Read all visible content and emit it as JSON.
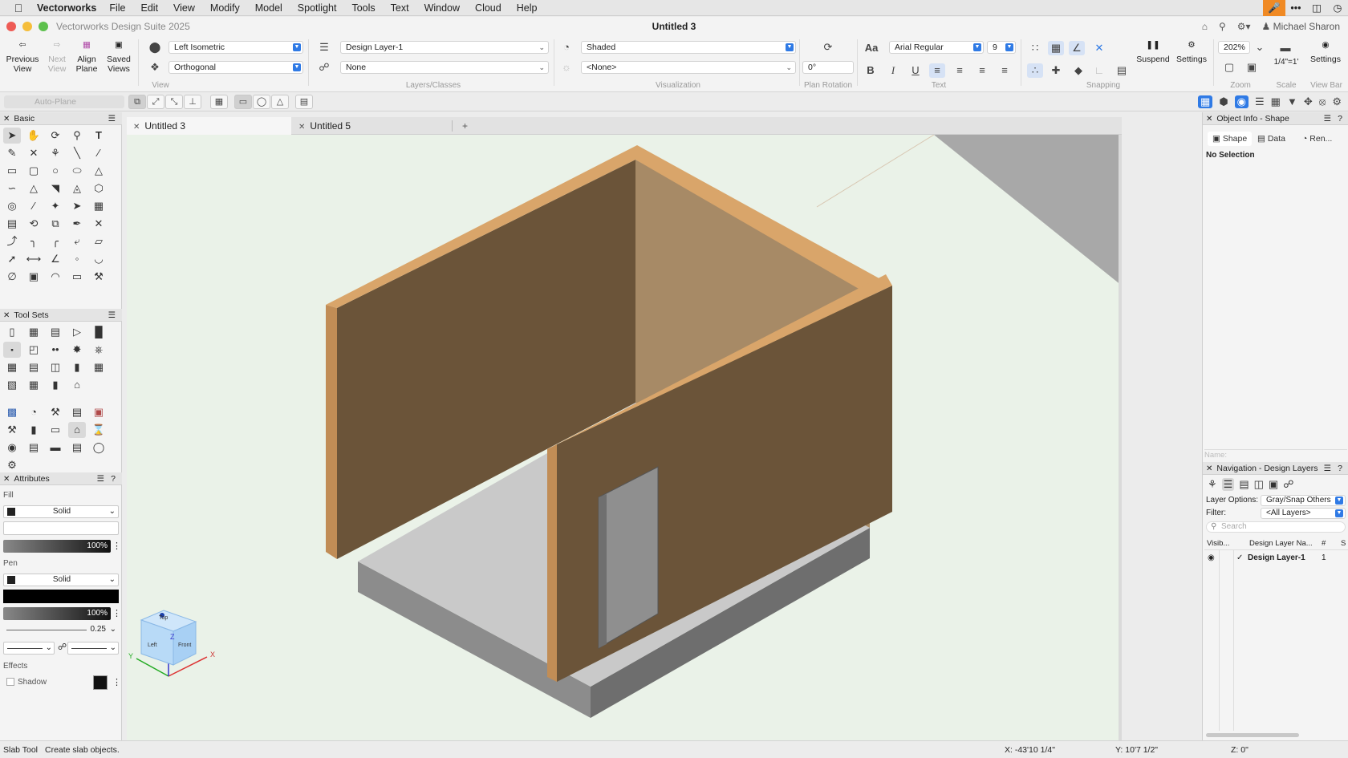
{
  "menubar": {
    "app": "Vectorworks",
    "items": [
      "File",
      "Edit",
      "View",
      "Modify",
      "Model",
      "Spotlight",
      "Tools",
      "Text",
      "Window",
      "Cloud",
      "Help"
    ]
  },
  "titlebar": {
    "suite": "Vectorworks Design Suite 2025",
    "document": "Untitled 3",
    "user": "Michael Sharon"
  },
  "toolbar": {
    "previous_view": "Previous View",
    "next_view": "Next View",
    "align_plane": "Align Plane",
    "saved_views": "Saved Views",
    "view_select": "Left Isometric",
    "projection_select": "Orthogonal",
    "view_label": "View",
    "layer_select": "Design Layer-1",
    "class_select": "None",
    "layers_label": "Layers/Classes",
    "render_select": "Shaded",
    "render2_select": "<None>",
    "visualization_label": "Visualization",
    "plan_rotation_value": "0°",
    "plan_rotation_label": "Plan Rotation",
    "font_select": "Arial Regular",
    "font_size": "9",
    "text_label": "Text",
    "snapping_label": "Snapping",
    "suspend": "Suspend",
    "settings": "Settings",
    "zoom_value": "202%",
    "zoom_label": "Zoom",
    "scale_value": "1/4\"=1'",
    "scale_label": "Scale",
    "settings2": "Settings",
    "view_bar_label": "View Bar"
  },
  "modebar": {
    "auto_plane": "Auto-Plane"
  },
  "left": {
    "basic_title": "Basic",
    "toolsets_title": "Tool Sets",
    "attributes_title": "Attributes",
    "fill_label": "Fill",
    "fill_style": "Solid",
    "fill_opacity": "100%",
    "pen_label": "Pen",
    "pen_style": "Solid",
    "pen_opacity": "100%",
    "line_weight": "0.25",
    "effects_label": "Effects",
    "shadow_label": "Shadow"
  },
  "tabs": [
    "Untitled 3",
    "Untitled 5"
  ],
  "view_cube": {
    "top": "Top",
    "left": "Left",
    "front": "Front",
    "axis_x": "X",
    "axis_y": "Y",
    "axis_z": "Z"
  },
  "object_info": {
    "title": "Object Info - Shape",
    "tabs": [
      "Shape",
      "Data",
      "Ren..."
    ],
    "no_selection": "No Selection",
    "name_label": "Name:"
  },
  "navigation": {
    "title": "Navigation - Design Layers",
    "layer_options_label": "Layer Options:",
    "layer_options_value": "Gray/Snap Others",
    "filter_label": "Filter:",
    "filter_value": "<All Layers>",
    "search_placeholder": "Search",
    "columns": [
      "Visib...",
      "Design Layer Na...",
      "#",
      "S"
    ],
    "rows": [
      {
        "name": "Design Layer-1",
        "number": "1"
      }
    ]
  },
  "status": {
    "tool": "Slab Tool",
    "hint": "Create slab objects.",
    "x": "X: -43'10 1/4\"",
    "y": "Y: 10'7 1/2\"",
    "z": "Z: 0\""
  },
  "colors": {
    "wall_top": "#d9a56a",
    "wall_inner_light": "#a78a66",
    "wall_dark": "#6b5439",
    "slab": "#a8a8a8",
    "floor": "#c8c8c8",
    "background": "#eaf2e8",
    "accent": "#2f7ae5"
  }
}
